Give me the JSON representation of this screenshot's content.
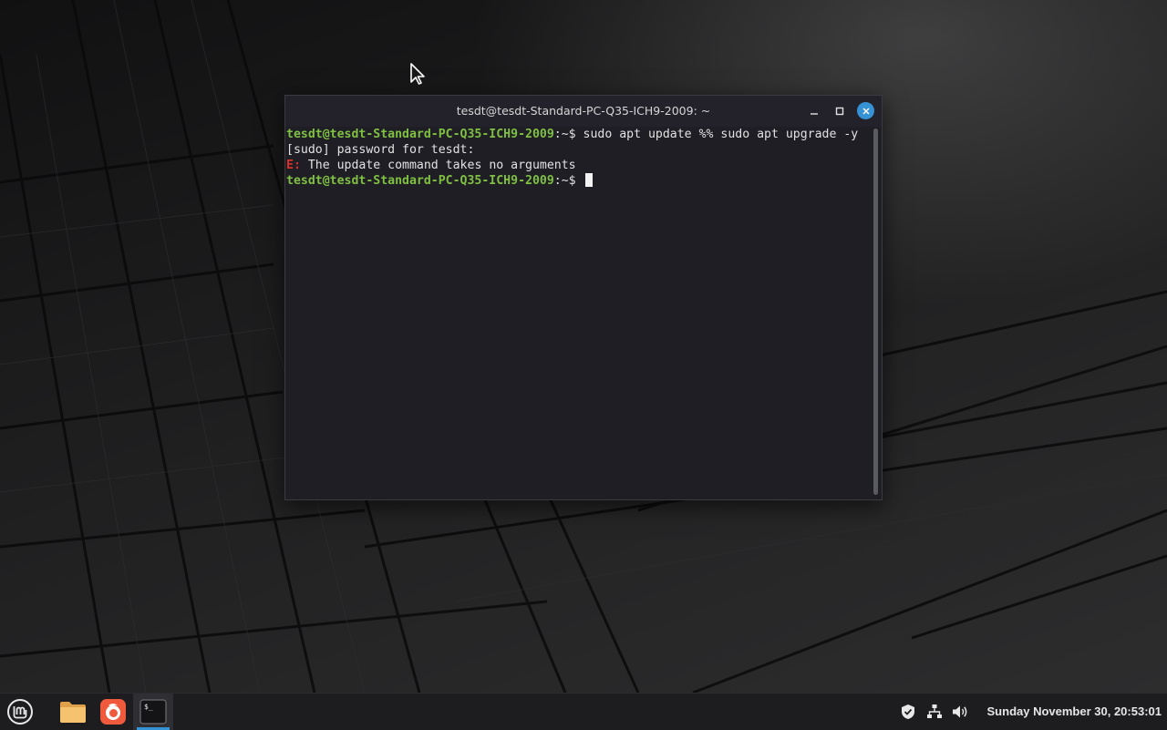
{
  "window": {
    "title": "tesdt@tesdt-Standard-PC-Q35-ICH9-2009: ~"
  },
  "terminal": {
    "prompt_user": "tesdt@tesdt-Standard-PC-Q35-ICH9-2009",
    "prompt_suffix": ":~$ ",
    "command1": "sudo apt update %% sudo apt upgrade -y",
    "line2": "[sudo] password for tesdt:",
    "error_prefix": "E:",
    "error_text": " The update command takes no arguments",
    "prompt_suffix2": ":~$ "
  },
  "taskbar": {
    "clock": "Sunday November 30, 20:53:01",
    "apps": [
      {
        "name": "menu-icon"
      },
      {
        "name": "folder-icon"
      },
      {
        "name": "firefox-icon"
      },
      {
        "name": "terminal-icon"
      }
    ],
    "tray": [
      "shield-icon",
      "network-icon",
      "volume-icon"
    ]
  },
  "colors": {
    "accent": "#3592d4",
    "prompt_green": "#7fc043",
    "error_red": "#d9302b"
  }
}
